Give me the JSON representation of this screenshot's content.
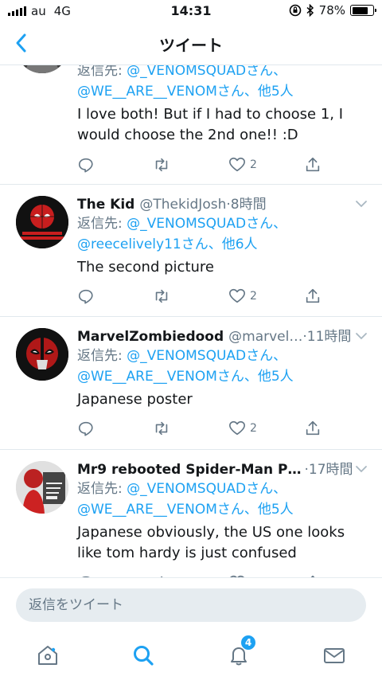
{
  "status_bar": {
    "carrier": "au",
    "network": "4G",
    "time": "14:31",
    "battery": "78%",
    "battery_level": 0.78
  },
  "nav": {
    "title": "ツイート"
  },
  "tweets": [
    {
      "name": "",
      "handle": "",
      "time": "",
      "reply_prefix": "返信先: ",
      "reply_line1_mention": "@_VENOMSQUADさん、",
      "reply_line2_mention": "@WE__ARE__VENOMさん、他5人",
      "text": "I love both! But if I had to choose 1, I would choose the 2nd one!! :D",
      "likes": "2"
    },
    {
      "name": "The Kid",
      "handle": "@ThekidJosh",
      "time": "8時間",
      "reply_prefix": "返信先: ",
      "reply_line1_mention": "@_VENOMSQUADさん、",
      "reply_line2_mention": "@reecelively11さん、他6人",
      "text": "The second picture",
      "likes": "2"
    },
    {
      "name": "MarvelZombiedood",
      "handle": "@marvel…",
      "time": "11時間",
      "reply_prefix": "返信先: ",
      "reply_line1_mention": "@_VENOMSQUADさん、",
      "reply_line2_mention": "@WE__ARE__VENOMさん、他5人",
      "text": "Japanese poster",
      "likes": "2"
    },
    {
      "name": "Mr9 rebooted Spider-Man P…",
      "handle": "",
      "time": "17時間",
      "reply_prefix": "返信先: ",
      "reply_line1_mention": "@_VENOMSQUADさん、",
      "reply_line2_mention": "@WE__ARE__VENOMさん、他5人",
      "text": "Japanese obviously, the US one looks like tom hardy is just confused",
      "likes": ""
    }
  ],
  "reply_bar": {
    "placeholder": "返信をツイート"
  },
  "tab_bar": {
    "notifications_badge": "4"
  },
  "colors": {
    "accent": "#1da1f2",
    "secondary_text": "#657786",
    "divider": "#e1e8ed"
  }
}
